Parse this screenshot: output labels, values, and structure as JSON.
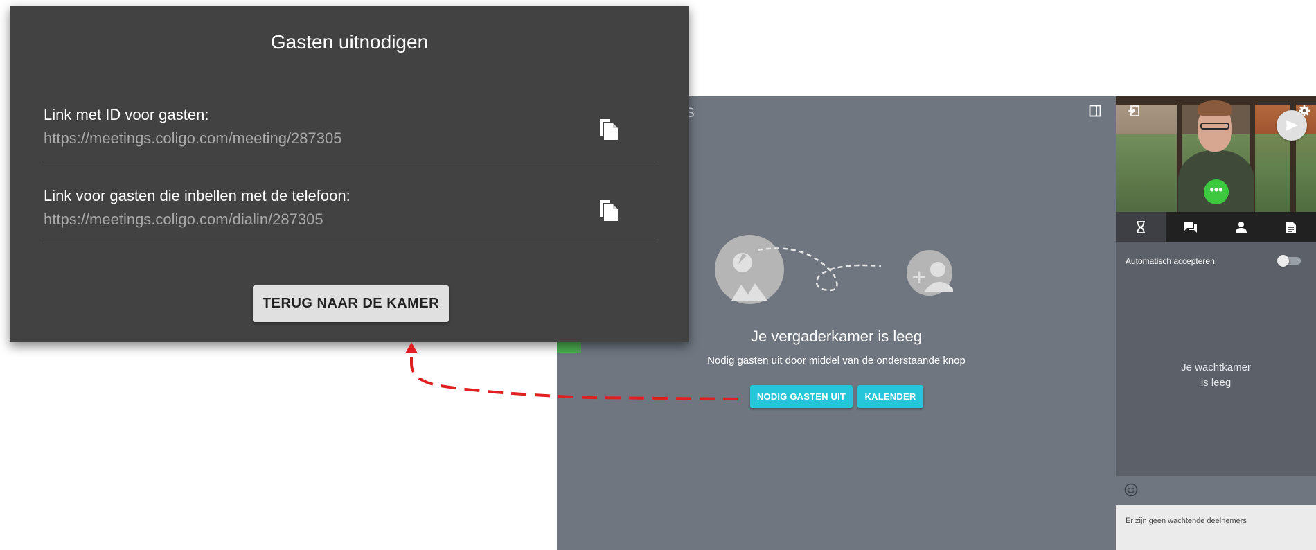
{
  "dialog": {
    "title": "Gasten uitnodigen",
    "links": [
      {
        "label": "Link met ID voor gasten:",
        "url": "https://meetings.coligo.com/meeting/287305"
      },
      {
        "label": "Link voor gasten die inbellen met de telefoon:",
        "url": "https://meetings.coligo.com/dialin/287305"
      }
    ],
    "back_button": "TERUG NAAR DE KAMER"
  },
  "room": {
    "title_fragment": "S",
    "empty_title": "Je vergaderkamer is leeg",
    "empty_subtitle": "Nodig gasten uit door middel van de onderstaande knop",
    "invite_button": "NODIG GASTEN UIT",
    "calendar_button": "KALENDER"
  },
  "sidebar": {
    "more_label": "•••",
    "tabs": [
      "hourglass-icon",
      "chat-icon",
      "person-icon",
      "document-icon"
    ],
    "auto_accept_label": "Automatisch accepteren",
    "auto_accept_on": false,
    "waiting_empty_line1": "Je wachtkamer",
    "waiting_empty_line2": "is leeg",
    "chat_footer": "Er zijn geen wachtende deelnemers"
  },
  "colors": {
    "accent": "#26c6da",
    "dialog_bg": "#424242",
    "room_bg": "#6f7680",
    "arrow": "#e02020",
    "status_green": "#3cc940"
  }
}
